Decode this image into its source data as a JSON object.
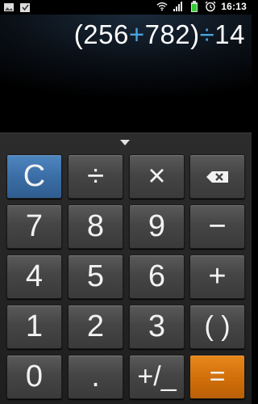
{
  "status_bar": {
    "time": "16:13",
    "left_icons": [
      "image-icon",
      "download-icon"
    ],
    "right_icons": [
      "wifi-icon",
      "signal-icon",
      "battery-icon",
      "alarm-icon"
    ],
    "battery_color": "#33cc33"
  },
  "display": {
    "expression_parts": [
      "(256",
      "+",
      "782)",
      "÷",
      "14"
    ],
    "operator_color": "#4aa3df"
  },
  "keypad": {
    "clear": "C",
    "divide": "÷",
    "multiply": "×",
    "backspace": "backspace-icon",
    "seven": "7",
    "eight": "8",
    "nine": "9",
    "minus": "−",
    "four": "4",
    "five": "5",
    "six": "6",
    "plus": "+",
    "one": "1",
    "two": "2",
    "three": "3",
    "parentheses": "( )",
    "zero": "0",
    "decimal": ".",
    "sign": "+/_",
    "equals": "=",
    "clear_color": "#3b6ea6",
    "equals_color": "#d06f0a"
  }
}
